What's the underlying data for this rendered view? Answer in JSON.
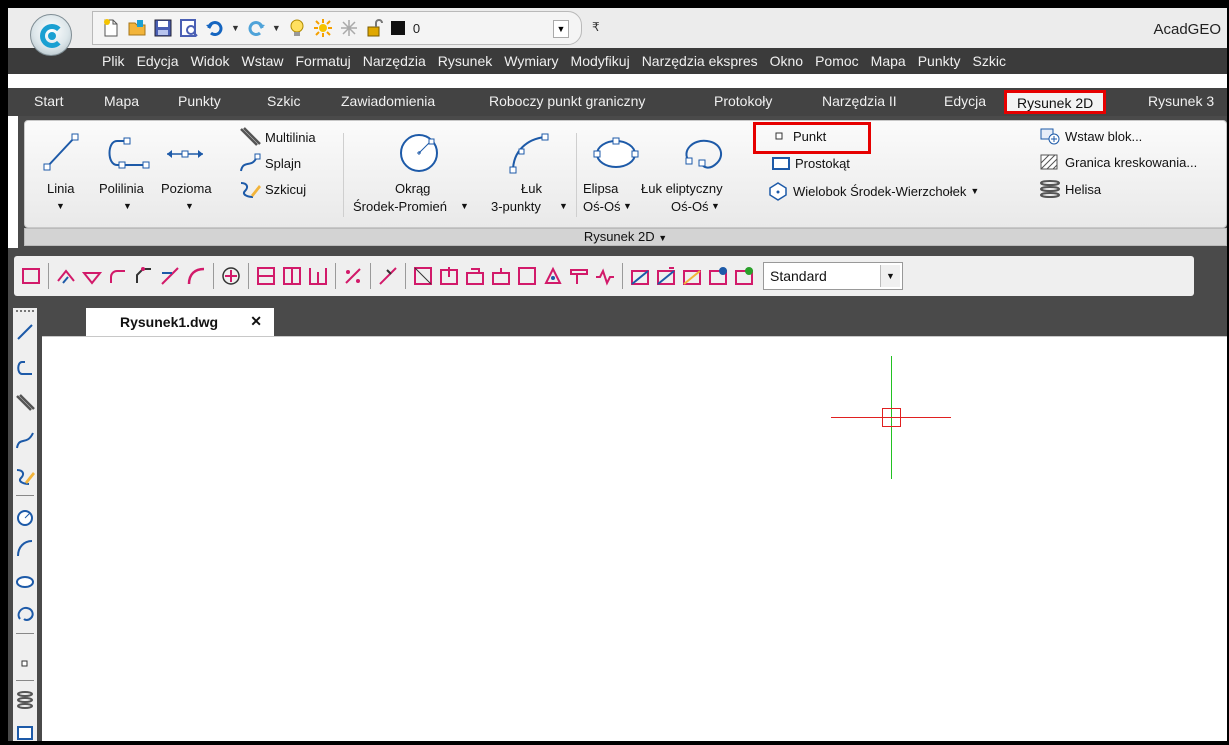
{
  "app_title": "AcadGEO",
  "quick_access": {
    "layer_value": "0",
    "more": "₹"
  },
  "menu": [
    "Plik",
    "Edycja",
    "Widok",
    "Wstaw",
    "Formatuj",
    "Narzędzia",
    "Rysunek",
    "Wymiary",
    "Modyfikuj",
    "Narzędzia ekspres",
    "Okno",
    "Pomoc",
    "Mapa",
    "Punkty",
    "Szkic"
  ],
  "ribbon_tabs": [
    "Start",
    "Mapa",
    "Punkty",
    "Szkic",
    "Zawiadomienia",
    "Roboczy punkt graniczny",
    "Protokoły",
    "Narzędzia II",
    "Edycja",
    "Rysunek 2D",
    "Rysunek 3"
  ],
  "active_tab": "Rysunek 2D",
  "ribbon": {
    "linia": "Linia",
    "polilinia": "Polilinia",
    "pozioma": "Pozioma",
    "multilinia": "Multilinia",
    "splajn": "Splajn",
    "szkicuj": "Szkicuj",
    "okrag": "Okrąg",
    "okrag_sub": "Środek-Promień",
    "luk": "Łuk",
    "luk_sub": "3-punkty",
    "elipsa": "Elipsa",
    "elipsa_sub": "Oś-Oś",
    "luk_elip": "Łuk eliptyczny",
    "luk_elip_sub": "Oś-Oś",
    "punkt": "Punkt",
    "prostokat": "Prostokąt",
    "wielobok": "Wielobok Środek-Wierzchołek",
    "wstaw_blok": "Wstaw blok...",
    "granica": "Granica kreskowania...",
    "helisa": "Helisa",
    "panel_title": "Rysunek 2D"
  },
  "toolbar": {
    "style_value": "Standard"
  },
  "document": {
    "tab_name": "Rysunek1.dwg",
    "close": "✕"
  },
  "colors": {
    "highlight": "#e60000",
    "crosshair_x": "#e02020",
    "crosshair_y": "#22c122"
  }
}
